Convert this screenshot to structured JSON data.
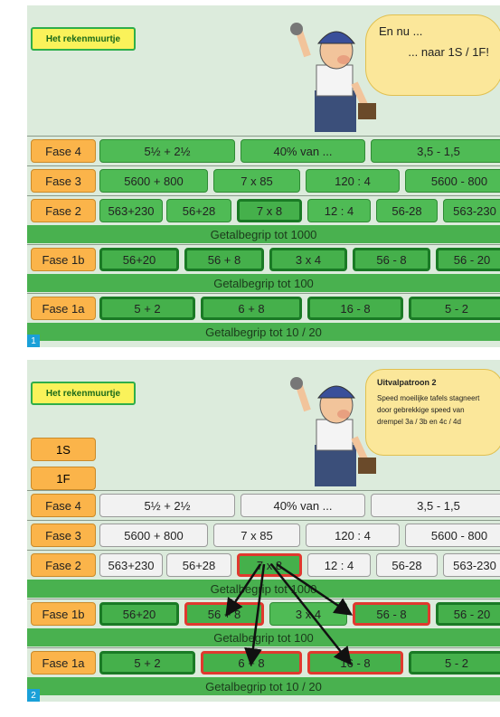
{
  "panel1": {
    "title": "Het rekenmuurtje",
    "speech_line1": "En nu ...",
    "speech_line2": "... naar 1S / 1F!",
    "number": "1",
    "rows": {
      "fase4": {
        "label": "Fase 4",
        "cells": [
          "5½ + 2½",
          "40% van ...",
          "3,5 - 1,5"
        ]
      },
      "fase3": {
        "label": "Fase 3",
        "cells": [
          "5600 + 800",
          "7 x 85",
          "120 : 4",
          "5600 - 800"
        ]
      },
      "fase2": {
        "label": "Fase 2",
        "cells": [
          "563+230",
          "56+28",
          "7 x 8",
          "12 : 4",
          "56-28",
          "563-230"
        ]
      },
      "band1000": "Getalbegrip tot 1000",
      "fase1b": {
        "label": "Fase 1b",
        "cells": [
          "56+20",
          "56 + 8",
          "3 x 4",
          "56 - 8",
          "56 - 20"
        ]
      },
      "band100": "Getalbegrip tot 100",
      "fase1a": {
        "label": "Fase 1a",
        "cells": [
          "5 + 2",
          "6 + 8",
          "16 - 8",
          "5 - 2"
        ]
      },
      "band20": "Getalbegrip tot 10 / 20"
    }
  },
  "panel2": {
    "title": "Het rekenmuurtje",
    "speech_head": "Uitvalpatroon 2",
    "speech_body": "Speed moeilijke tafels stagneert door gebrekkige speed van drempel 3a / 3b en 4c / 4d",
    "tag1s": "1S",
    "tag1f": "1F",
    "number": "2",
    "rows": {
      "fase4": {
        "label": "Fase 4",
        "cells": [
          "5½ + 2½",
          "40% van ...",
          "3,5 - 1,5"
        ]
      },
      "fase3": {
        "label": "Fase 3",
        "cells": [
          "5600 + 800",
          "7 x 85",
          "120 : 4",
          "5600 - 800"
        ]
      },
      "fase2": {
        "label": "Fase 2",
        "cells": [
          "563+230",
          "56+28",
          "7 x 8",
          "12 : 4",
          "56-28",
          "563-230"
        ]
      },
      "band1000": "Getalbegrip tot 1000",
      "fase1b": {
        "label": "Fase 1b",
        "cells": [
          "56+20",
          "56 + 8",
          "3 x 4",
          "56 - 8",
          "56 - 20"
        ]
      },
      "band100": "Getalbegrip tot 100",
      "fase1a": {
        "label": "Fase 1a",
        "cells": [
          "5 + 2",
          "6 + 8",
          "16 - 8",
          "5 - 2"
        ]
      },
      "band20": "Getalbegrip tot 10 / 20"
    }
  },
  "colors": {
    "fase": "#fbb44a",
    "green": "#45b04b",
    "red_outline": "#e0392e",
    "title_yellow": "#faf25a",
    "badge_blue": "#1aa0d8"
  }
}
